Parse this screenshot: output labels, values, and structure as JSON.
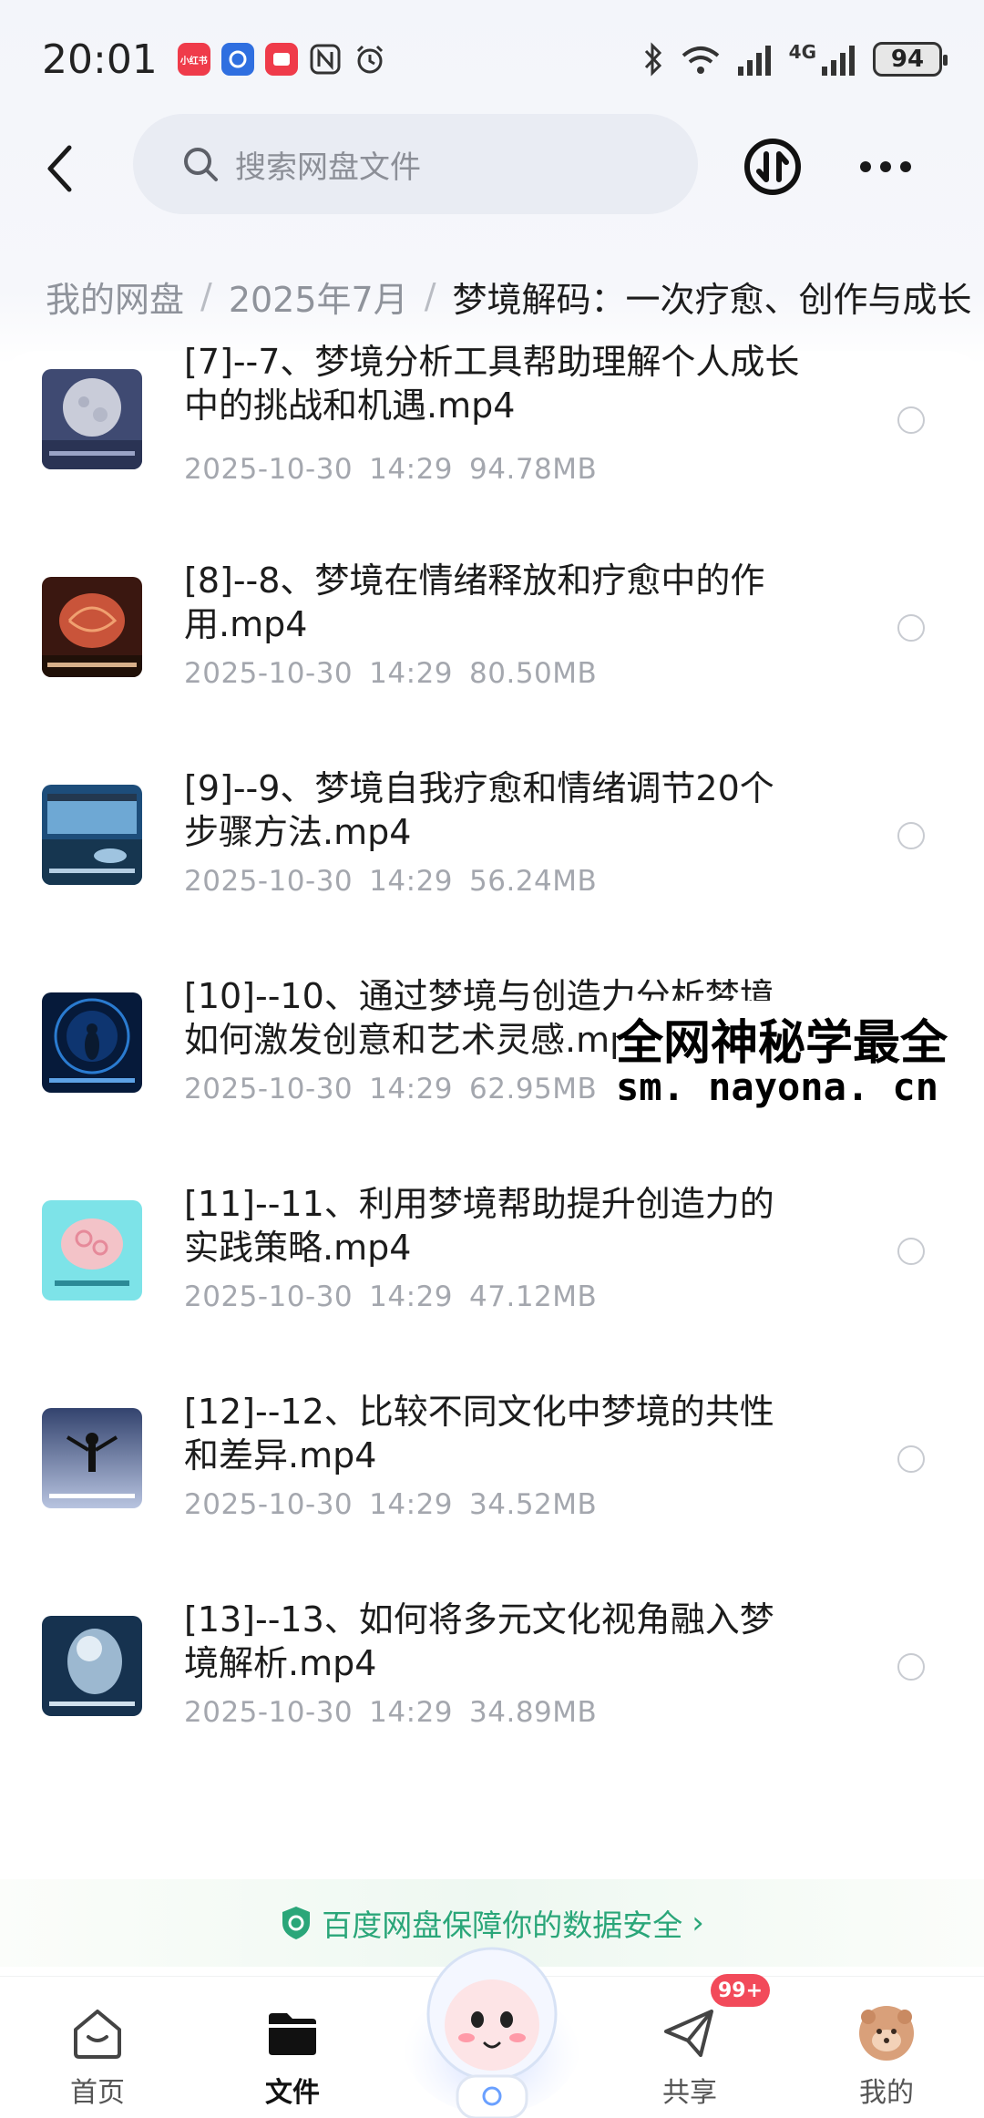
{
  "status_bar": {
    "time": "20:01",
    "app_badges": [
      {
        "name": "xiaohongshu",
        "text": "小红书",
        "color": "#ef3b4a"
      },
      {
        "name": "app-blue",
        "text": "",
        "color": "#2f6fe0"
      },
      {
        "name": "app-red",
        "text": "",
        "color": "#ef3b4a"
      }
    ],
    "network_label": "4G",
    "battery": "94"
  },
  "header": {
    "search_placeholder": "搜索网盘文件"
  },
  "breadcrumb": {
    "items": [
      "我的网盘",
      "2025年7月"
    ],
    "current": "梦境解码：一次疗愈、创作与成长"
  },
  "files": [
    {
      "name_line1": "[7]--7、梦境分析工具帮助理解个人成长",
      "name_line2": "中的挑战和机遇.mp4",
      "date": "2025-10-30",
      "time": "14:29",
      "size": "94.78MB",
      "thumb": "moon"
    },
    {
      "name_line1": "[8]--8、梦境在情绪释放和疗愈中的作",
      "name_line2": "用.mp4",
      "date": "2025-10-30",
      "time": "14:29",
      "size": "80.50MB",
      "thumb": "brain-red"
    },
    {
      "name_line1": "[9]--9、梦境自我疗愈和情绪调节20个",
      "name_line2": "步骤方法.mp4",
      "date": "2025-10-30",
      "time": "14:29",
      "size": "56.24MB",
      "thumb": "window"
    },
    {
      "name_line1": "[10]--10、通过梦境与创造力分析梦境",
      "name_line2": "如何激发创意和艺术灵感.mp4",
      "date": "2025-10-30",
      "time": "14:29",
      "size": "62.95MB",
      "thumb": "portal"
    },
    {
      "name_line1": "[11]--11、利用梦境帮助提升创造力的",
      "name_line2": "实践策略.mp4",
      "date": "2025-10-30",
      "time": "14:29",
      "size": "47.12MB",
      "thumb": "brain-cyan"
    },
    {
      "name_line1": "[12]--12、比较不同文化中梦境的共性",
      "name_line2": "和差异.mp4",
      "date": "2025-10-30",
      "time": "14:29",
      "size": "34.52MB",
      "thumb": "person"
    },
    {
      "name_line1": "[13]--13、如何将多元文化视角融入梦",
      "name_line2": "境解析.mp4",
      "date": "2025-10-30",
      "time": "14:29",
      "size": "34.89MB",
      "thumb": "head"
    }
  ],
  "watermark": {
    "line1": "全网神秘学最全",
    "line2": "sm. nayona. cn"
  },
  "security_banner": {
    "text": "百度网盘保障你的数据安全",
    "color": "#2aa679"
  },
  "bottom_nav": {
    "items": [
      {
        "label": "首页",
        "icon": "home-icon"
      },
      {
        "label": "文件",
        "icon": "folder-icon",
        "active": true
      },
      {
        "label": "共享",
        "icon": "share-icon"
      },
      {
        "label": "我的",
        "icon": "avatar-icon"
      }
    ],
    "share_badge": "99+"
  }
}
